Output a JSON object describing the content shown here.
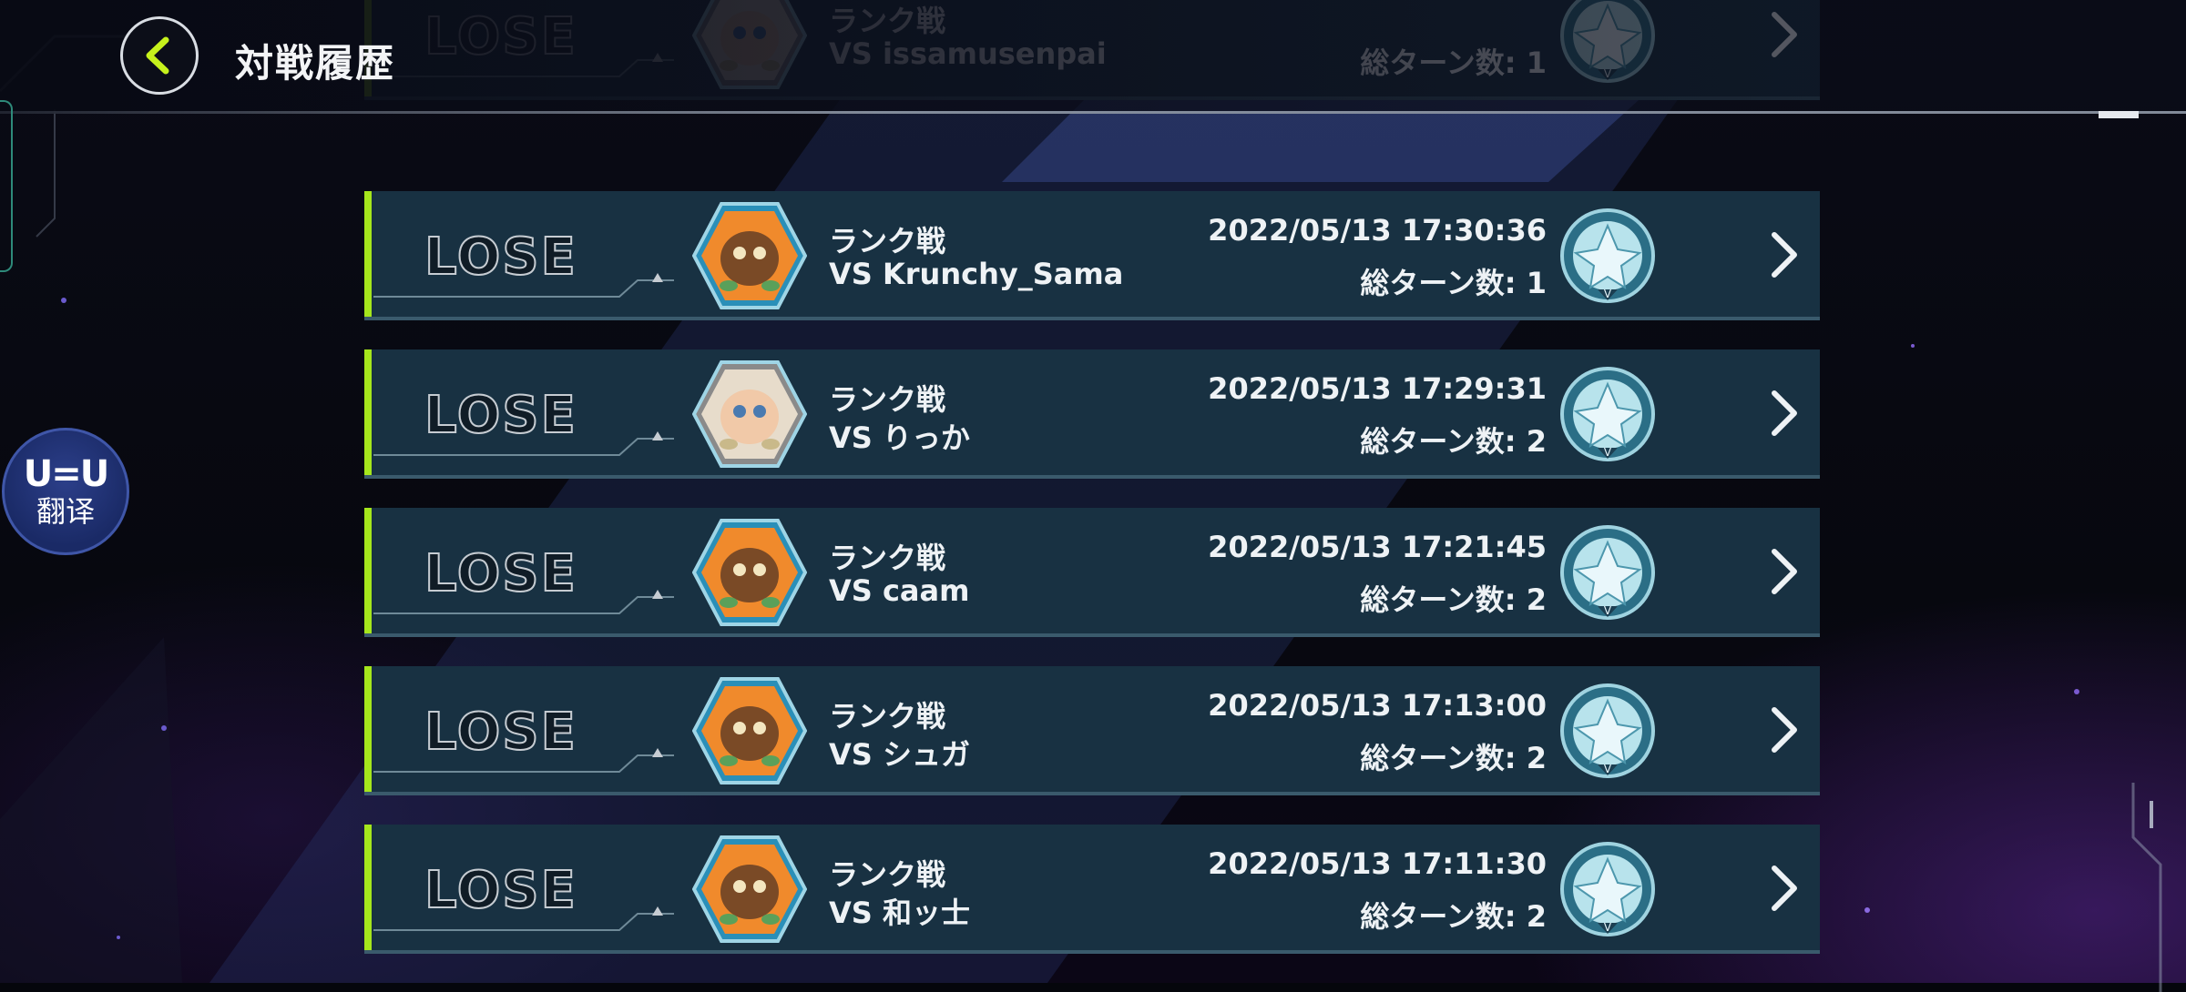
{
  "header": {
    "title": "対戦履歴",
    "back_icon": "chevron-left-icon"
  },
  "translate_widget": {
    "logo": "U=U",
    "label": "翻译"
  },
  "colors": {
    "accent_green": "#a5e61c",
    "row_bg": "#183142",
    "row_border": "#3a5a6c"
  },
  "matches": [
    {
      "result": "LOSE",
      "mode": "ランク戦",
      "opponent": "VS issamusenpai",
      "datetime": "",
      "turns": "総ターン数: 1",
      "avatar": "avatar-white-hair-icon"
    },
    {
      "result": "LOSE",
      "mode": "ランク戦",
      "opponent": "VS Krunchy_Sama",
      "datetime": "2022/05/13 17:30:36",
      "turns": "総ターン数: 1",
      "avatar": "kuriboh-avatar-icon"
    },
    {
      "result": "LOSE",
      "mode": "ランク戦",
      "opponent": "VS りっか",
      "datetime": "2022/05/13 17:29:31",
      "turns": "総ターン数: 2",
      "avatar": "avatar-girl-icon"
    },
    {
      "result": "LOSE",
      "mode": "ランク戦",
      "opponent": "VS caam",
      "datetime": "2022/05/13 17:21:45",
      "turns": "総ターン数: 2",
      "avatar": "kuriboh-avatar-icon"
    },
    {
      "result": "LOSE",
      "mode": "ランク戦",
      "opponent": "VS シュガ",
      "datetime": "2022/05/13 17:13:00",
      "turns": "総ターン数: 2",
      "avatar": "kuriboh-avatar-icon"
    },
    {
      "result": "LOSE",
      "mode": "ランク戦",
      "opponent": "VS 和ッ士",
      "datetime": "2022/05/13 17:11:30",
      "turns": "総ターン数: 2",
      "avatar": "kuriboh-avatar-icon"
    }
  ]
}
